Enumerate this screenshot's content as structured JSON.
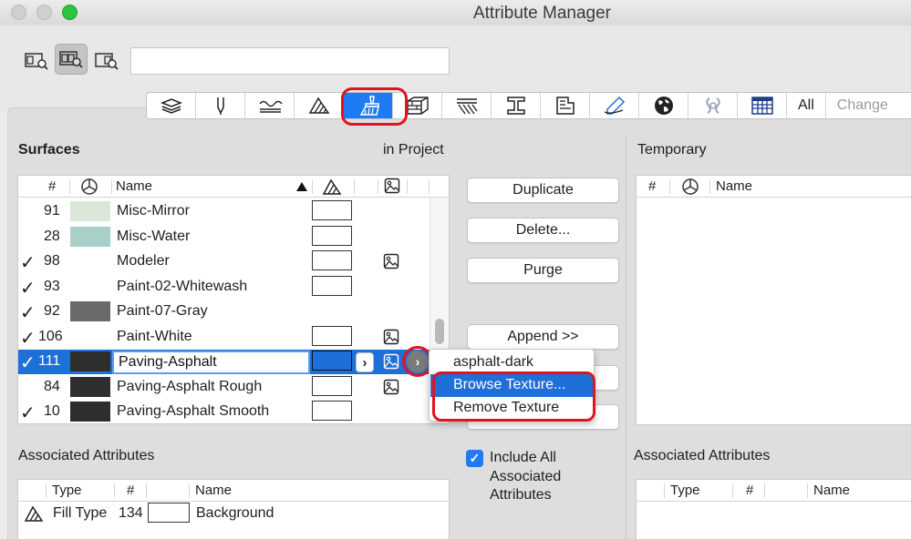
{
  "window": {
    "title": "Attribute Manager"
  },
  "left_panel": {
    "title": "Surfaces",
    "subtitle": "in Project",
    "columns": {
      "number": "#",
      "name": "Name"
    },
    "rows": [
      {
        "checked": false,
        "number": "91",
        "name": "Misc-Mirror",
        "color": "#dce8d7",
        "pen_box": true,
        "texture": false
      },
      {
        "checked": false,
        "number": "28",
        "name": "Misc-Water",
        "color": "#a8d0c9",
        "pen_box": true,
        "texture": false
      },
      {
        "checked": true,
        "number": "98",
        "name": "Modeler",
        "color": "#ffffff",
        "pen_box": true,
        "texture": true
      },
      {
        "checked": true,
        "number": "93",
        "name": "Paint-02-Whitewash",
        "color": "#ffffff",
        "pen_box": true,
        "texture": false
      },
      {
        "checked": true,
        "number": "92",
        "name": "Paint-07-Gray",
        "color": "#6a6a6a",
        "pen_box": false,
        "texture": false
      },
      {
        "checked": true,
        "number": "106",
        "name": "Paint-White",
        "color": "#ffffff",
        "pen_box": true,
        "texture": true
      },
      {
        "checked": true,
        "number": "111",
        "name": "Paving-Asphalt",
        "color": "#2e2e2e",
        "pen_box": true,
        "texture": true,
        "selected": true
      },
      {
        "checked": false,
        "number": "84",
        "name": "Paving-Asphalt Rough",
        "color": "#2e2e2e",
        "pen_box": true,
        "texture": true
      },
      {
        "checked": true,
        "number": "10",
        "name": "Paving-Asphalt Smooth",
        "color": "#2e2e2e",
        "pen_box": true,
        "texture": false
      }
    ]
  },
  "actions": {
    "duplicate": "Duplicate",
    "delete": "Delete...",
    "purge": "Purge",
    "append": "Append >>"
  },
  "context_menu": {
    "items": [
      "asphalt-dark",
      "Browse Texture...",
      "Remove Texture"
    ],
    "highlighted_index": 1
  },
  "right_panel": {
    "title": "Temporary",
    "columns": {
      "number": "#",
      "name": "Name"
    }
  },
  "associated_left": {
    "title": "Associated Attributes",
    "columns": {
      "type": "Type",
      "number": "#",
      "name": "Name"
    },
    "row": {
      "type": "Fill Type",
      "number": "134",
      "name": "Background"
    }
  },
  "associated_right": {
    "title": "Associated Attributes",
    "columns": {
      "type": "Type",
      "number": "#",
      "name": "Name"
    }
  },
  "include_all": {
    "label": "Include All Associated Attributes",
    "checked": true
  },
  "type_toolbar": {
    "all_label": "All",
    "change_label": "Change"
  },
  "colors": {
    "accent": "#1f7bf3",
    "selection": "#1f6fd8",
    "highlight_ring": "#e0141e"
  }
}
